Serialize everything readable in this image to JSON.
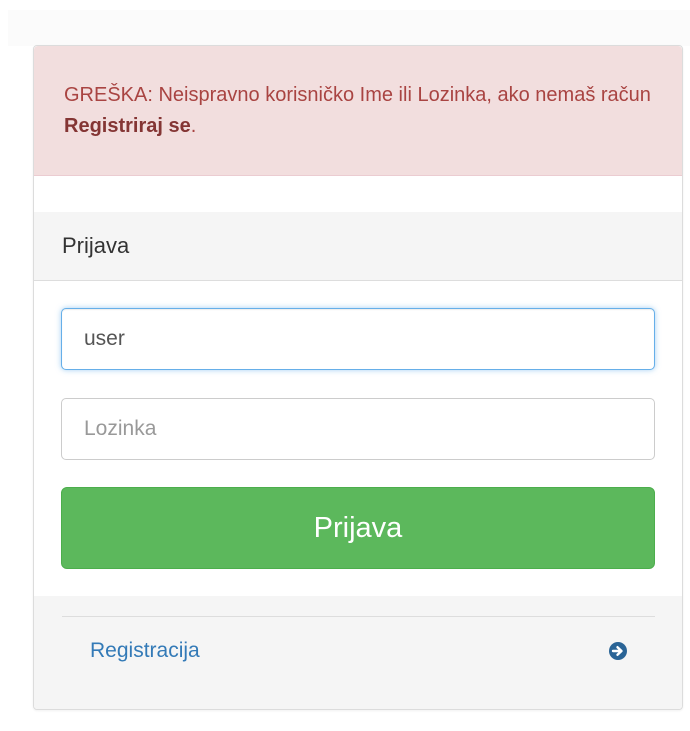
{
  "alert": {
    "text_before": "GREŠKA: Neispravno korisničko Ime ili Lozinka, ako nemaš račun ",
    "link_text": "Registriraj se",
    "text_after": "."
  },
  "panel": {
    "heading": "Prijava"
  },
  "form": {
    "username_value": "user",
    "password_placeholder": "Lozinka",
    "submit_label": "Prijava"
  },
  "footer": {
    "register_label": "Registracija",
    "register_icon": "arrow-circle-right-icon"
  },
  "colors": {
    "alert_bg": "#f2dede",
    "alert_text": "#a94442",
    "button_green": "#5cb85c",
    "link_blue": "#337ab7",
    "focus_border": "#66afe9"
  }
}
